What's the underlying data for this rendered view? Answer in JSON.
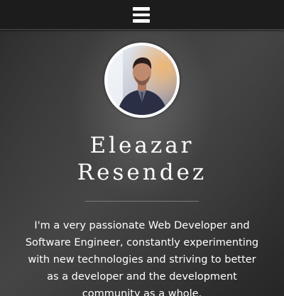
{
  "header": {
    "menu_icon": "hamburger-menu-icon"
  },
  "profile": {
    "name_first": "Eleazar",
    "name_last": "Resendez",
    "bio": "I'm a very passionate Web Developer and Software Engineer, constantly experimenting with new technologies and striving to better as a developer and the development community as a whole."
  },
  "colors": {
    "topbar": "#1c1c1c",
    "text": "#ffffff",
    "divider": "#7a7a7a"
  }
}
